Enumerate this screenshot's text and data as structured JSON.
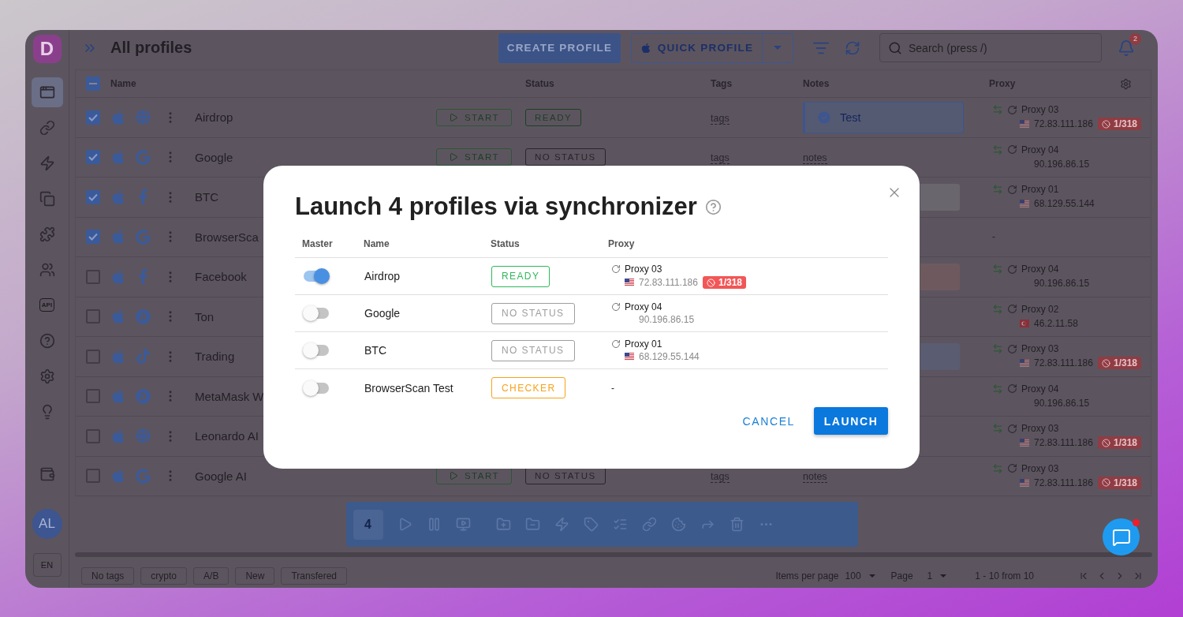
{
  "sidebar": {
    "logo": "D",
    "items": [
      {
        "kind": "browser",
        "selected": true
      },
      {
        "kind": "link",
        "selected": false
      },
      {
        "kind": "automation",
        "selected": false
      },
      {
        "kind": "copy",
        "selected": false
      },
      {
        "kind": "extension",
        "selected": false
      },
      {
        "kind": "team",
        "selected": false
      },
      {
        "kind": "api",
        "text": "API",
        "selected": false
      },
      {
        "kind": "help",
        "selected": false
      },
      {
        "kind": "settings",
        "selected": false
      },
      {
        "kind": "idea",
        "selected": false
      },
      {
        "kind": "wallet",
        "selected": false
      }
    ],
    "avatar": "AL",
    "language": "EN"
  },
  "header": {
    "title": "All profiles",
    "create_button": "CREATE PROFILE",
    "quick_button": "QUICK PROFILE",
    "search": {
      "placeholder": "Search (press /)"
    },
    "notifications": "2"
  },
  "table": {
    "select_all_partial": true,
    "columns": [
      "Name",
      "Status",
      "Tags",
      "Notes",
      "Proxy"
    ],
    "rows": [
      {
        "checked": true,
        "site": {
          "kind": "globe"
        },
        "name": "Airdrop",
        "start": "START",
        "status": {
          "text": "READY",
          "kind": "ready"
        },
        "tags": "tags",
        "note": {
          "kind": "tag",
          "text": "Test"
        },
        "proxy": {
          "name": "Proxy 03",
          "flag": {
            "kind": "us"
          },
          "ip": "72.83.111.186",
          "badge": "1/318"
        }
      },
      {
        "checked": true,
        "site": {
          "kind": "google"
        },
        "name": "Google",
        "start": "START",
        "status": {
          "text": "NO STATUS",
          "kind": "none"
        },
        "tags": "tags",
        "note": {
          "kind": "text",
          "text": "notes"
        },
        "proxy": {
          "name": "Proxy 04",
          "ip": "90.196.86.15"
        }
      },
      {
        "checked": true,
        "site": {
          "kind": "facebook"
        },
        "name": "BTC",
        "note": {
          "kind": "block",
          "color": "#6a666d"
        },
        "proxy": {
          "name": "Proxy 01",
          "flag": {
            "kind": "us"
          },
          "ip": "68.129.55.144"
        }
      },
      {
        "checked": true,
        "site": {
          "kind": "google"
        },
        "name": "BrowserSca",
        "proxy": {
          "empty": "-"
        }
      },
      {
        "checked": false,
        "site": {
          "kind": "facebook"
        },
        "name": "Facebook",
        "note": {
          "kind": "block",
          "color": "#6e5a5e"
        },
        "proxy": {
          "name": "Proxy 04",
          "ip": "90.196.86.15"
        }
      },
      {
        "checked": false,
        "site": {
          "kind": "bitcoin"
        },
        "name": "Ton",
        "proxy": {
          "name": "Proxy 02",
          "flag": {
            "kind": "tr"
          },
          "ip": "46.2.11.58"
        }
      },
      {
        "checked": false,
        "site": {
          "kind": "tiktok"
        },
        "name": "Trading",
        "note": {
          "kind": "block",
          "color": "#5a5c72"
        },
        "proxy": {
          "name": "Proxy 03",
          "flag": {
            "kind": "us"
          },
          "ip": "72.83.111.186",
          "badge": "1/318"
        }
      },
      {
        "checked": false,
        "site": {
          "kind": "bitcoin"
        },
        "name": "MetaMask W",
        "proxy": {
          "name": "Proxy 04",
          "ip": "90.196.86.15"
        }
      },
      {
        "checked": false,
        "site": {
          "kind": "globe"
        },
        "name": "Leonardo AI",
        "proxy": {
          "name": "Proxy 03",
          "flag": {
            "kind": "us"
          },
          "ip": "72.83.111.186",
          "badge": "1/318"
        }
      },
      {
        "checked": false,
        "site": {
          "kind": "google"
        },
        "name": "Google AI",
        "start": "START",
        "status": {
          "text": "NO STATUS",
          "kind": "none"
        },
        "tags": "tags",
        "note": {
          "kind": "text",
          "text": "notes"
        },
        "proxy": {
          "name": "Proxy 03",
          "flag": {
            "kind": "us"
          },
          "ip": "72.83.111.186",
          "badge": "1/318"
        }
      }
    ]
  },
  "toolbar": {
    "count": "4",
    "actions": [
      {
        "kind": "play"
      },
      {
        "kind": "pause"
      },
      {
        "kind": "screen"
      },
      {
        "kind": "folder-add"
      },
      {
        "kind": "folder-remove"
      },
      {
        "kind": "automation"
      },
      {
        "kind": "tag"
      },
      {
        "kind": "list"
      },
      {
        "kind": "link"
      },
      {
        "kind": "cookie"
      },
      {
        "kind": "share"
      },
      {
        "kind": "delete"
      },
      {
        "kind": "more"
      }
    ]
  },
  "footer": {
    "tags": [
      "No tags",
      "crypto",
      "A/B",
      "New",
      "Transfered"
    ],
    "items_per_page": {
      "label": "Items per page",
      "value": "100"
    },
    "page": {
      "label": "Page",
      "value": "1"
    },
    "range": "1 - 10 from 10"
  },
  "modal": {
    "title": "Launch 4 profiles via synchronizer",
    "columns": [
      "Master",
      "Name",
      "Status",
      "Proxy"
    ],
    "rows": [
      {
        "master": true,
        "name": "Airdrop",
        "status": {
          "text": "READY",
          "kind": "ready"
        },
        "proxy": {
          "name": "Proxy 03",
          "flag": {
            "kind": "us"
          },
          "ip": "72.83.111.186",
          "badge": "1/318"
        }
      },
      {
        "master": false,
        "name": "Google",
        "status": {
          "text": "NO STATUS",
          "kind": "none"
        },
        "proxy": {
          "name": "Proxy 04",
          "ip": "90.196.86.15"
        }
      },
      {
        "master": false,
        "name": "BTC",
        "status": {
          "text": "NO STATUS",
          "kind": "none"
        },
        "proxy": {
          "name": "Proxy 01",
          "flag": {
            "kind": "us"
          },
          "ip": "68.129.55.144"
        }
      },
      {
        "master": false,
        "name": "BrowserScan Test",
        "status": {
          "text": "CHECKER",
          "kind": "checker"
        },
        "proxy": {
          "empty": "-"
        }
      }
    ],
    "cancel": "CANCEL",
    "launch": "LAUNCH"
  },
  "chat": {
    "unread": true
  }
}
